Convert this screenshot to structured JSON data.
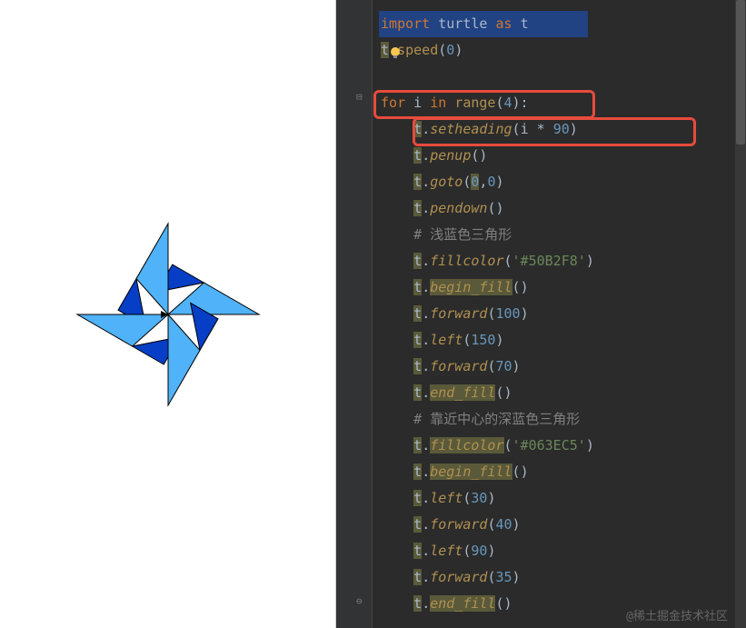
{
  "watermark": "@稀土掘金技术社区",
  "tab_hint": ". ,",
  "turtle": {
    "light_color": "#50B2F8",
    "dark_color": "#063EC5",
    "outline": "#000000",
    "blades": 4,
    "forward1": 100,
    "left1": 150,
    "forward2": 70,
    "left2": 30,
    "forward3": 40,
    "left3": 90,
    "forward4": 35
  },
  "code": {
    "l1": {
      "kw": "import",
      "mod": "turtle",
      "as": "as",
      "alias": "t"
    },
    "l2": {
      "obj": "t",
      "dot": ".",
      "fn": "speed",
      "lp": "(",
      "arg": "0",
      "rp": ")"
    },
    "l4": {
      "kw": "for",
      "var": "i",
      "in": "in",
      "fn": "range",
      "lp": "(",
      "arg": "4",
      "rp": "):"
    },
    "l5": {
      "obj": "t",
      "dot": ".",
      "fn": "setheading",
      "lp": "(",
      "arg1": "i",
      "op": " * ",
      "arg2": "90",
      "rp": ")"
    },
    "l6": {
      "obj": "t",
      "dot": ".",
      "fn": "penup",
      "lp": "(",
      "rp": ")"
    },
    "l7": {
      "obj": "t",
      "dot": ".",
      "fn": "goto",
      "lp": "(",
      "a1": "0",
      "comma": ",",
      "a2": "0",
      "rp": ")"
    },
    "l8": {
      "obj": "t",
      "dot": ".",
      "fn": "pendown",
      "lp": "(",
      "rp": ")"
    },
    "l9": {
      "text": "# 浅蓝色三角形"
    },
    "l10": {
      "obj": "t",
      "dot": ".",
      "fn": "fillcolor",
      "lp": "(",
      "arg": "'#50B2F8'",
      "rp": ")"
    },
    "l11": {
      "obj": "t",
      "dot": ".",
      "fn": "begin_fill",
      "lp": "(",
      "rp": ")"
    },
    "l12": {
      "obj": "t",
      "dot": ".",
      "fn": "forward",
      "lp": "(",
      "arg": "100",
      "rp": ")"
    },
    "l13": {
      "obj": "t",
      "dot": ".",
      "fn": "left",
      "lp": "(",
      "arg": "150",
      "rp": ")"
    },
    "l14": {
      "obj": "t",
      "dot": ".",
      "fn": "forward",
      "lp": "(",
      "arg": "70",
      "rp": ")"
    },
    "l15": {
      "obj": "t",
      "dot": ".",
      "fn": "end_fill",
      "lp": "(",
      "rp": ")"
    },
    "l16": {
      "text": "# 靠近中心的深蓝色三角形"
    },
    "l17": {
      "obj": "t",
      "dot": ".",
      "fn": "fillcolor",
      "lp": "(",
      "arg": "'#063EC5'",
      "rp": ")"
    },
    "l18": {
      "obj": "t",
      "dot": ".",
      "fn": "begin_fill",
      "lp": "(",
      "rp": ")"
    },
    "l19": {
      "obj": "t",
      "dot": ".",
      "fn": "left",
      "lp": "(",
      "arg": "30",
      "rp": ")"
    },
    "l20": {
      "obj": "t",
      "dot": ".",
      "fn": "forward",
      "lp": "(",
      "arg": "40",
      "rp": ")"
    },
    "l21": {
      "obj": "t",
      "dot": ".",
      "fn": "left",
      "lp": "(",
      "arg": "90",
      "rp": ")"
    },
    "l22": {
      "obj": "t",
      "dot": ".",
      "fn": "forward",
      "lp": "(",
      "arg": "35",
      "rp": ")"
    },
    "l23": {
      "obj": "t",
      "dot": ".",
      "fn": "end_fill",
      "lp": "(",
      "rp": ")"
    }
  }
}
